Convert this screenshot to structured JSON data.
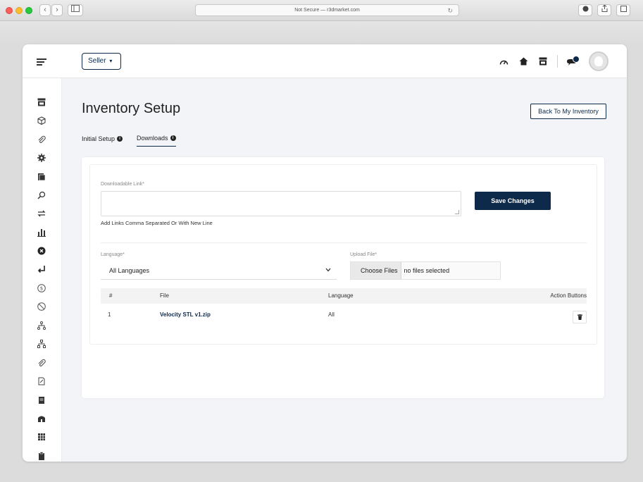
{
  "browser": {
    "address": "Not Secure — r3dmarket.com",
    "back": "‹",
    "forward": "›"
  },
  "header": {
    "seller_label": "Seller",
    "seller_caret": "▾"
  },
  "page": {
    "title": "Inventory Setup",
    "back_button": "Back To My Inventory",
    "tabs": [
      {
        "label": "Initial Setup",
        "active": false
      },
      {
        "label": "Downloads",
        "active": true
      }
    ]
  },
  "form": {
    "link_label": "Downloadable Link*",
    "link_value": "",
    "save_label": "Save Changes",
    "hint": "Add Links Comma Separated Or With New Line",
    "language_label": "Language*",
    "language_value": "All Languages",
    "upload_label": "Upload File*",
    "choose_files": "Choose Files",
    "no_files": "no files selected"
  },
  "table": {
    "headers": [
      "#",
      "File",
      "Language",
      "Action Buttons"
    ],
    "rows": [
      {
        "num": "1",
        "file": "Velocity STL v1.zip",
        "language": "All"
      }
    ]
  },
  "colors": {
    "accent": "#0d2a4a",
    "background": "#f3f4f7"
  }
}
